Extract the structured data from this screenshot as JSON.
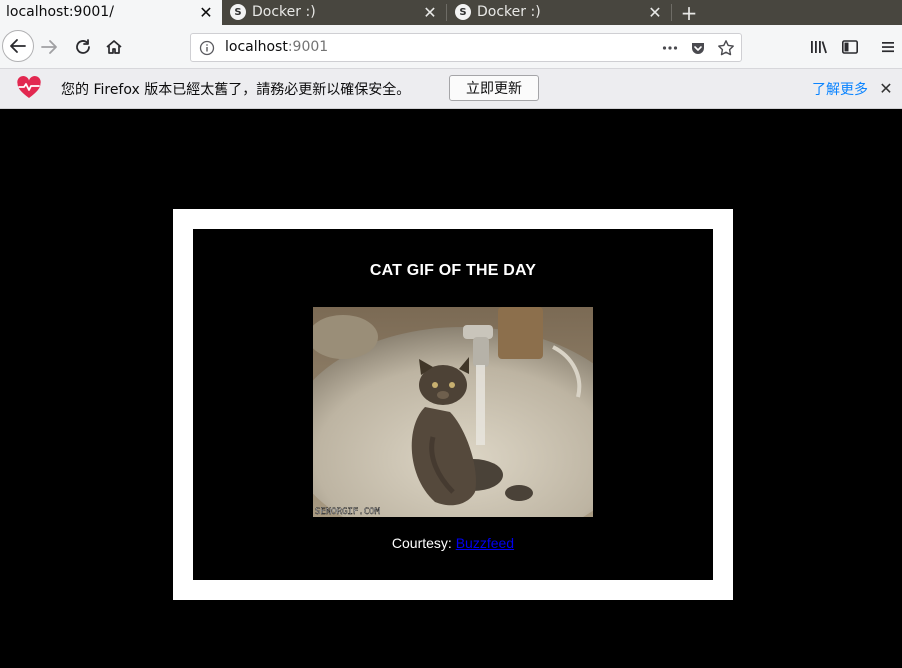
{
  "browser": {
    "tabs": [
      {
        "title": "localhost:9001/",
        "active": true
      },
      {
        "title": "Docker :)",
        "active": false,
        "favicon": "S"
      },
      {
        "title": "Docker :)",
        "active": false,
        "favicon": "S"
      }
    ],
    "url_host": "localhost",
    "url_port": ":9001"
  },
  "notification": {
    "message": "您的 Firefox 版本已經太舊了，請務必更新以確保安全。",
    "update_button": "立即更新",
    "learn_more": "了解更多"
  },
  "page": {
    "title": "CAT GIF OF THE DAY",
    "watermark": "SENORGIF.COM",
    "courtesy_label": "Courtesy:",
    "courtesy_link": "Buzzfeed"
  },
  "colors": {
    "tab_strip": "#48463f",
    "toolbar": "#f5f6f7",
    "link_blue": "#0a84ff",
    "page_bg": "#000000",
    "card_border": "#ffffff"
  }
}
